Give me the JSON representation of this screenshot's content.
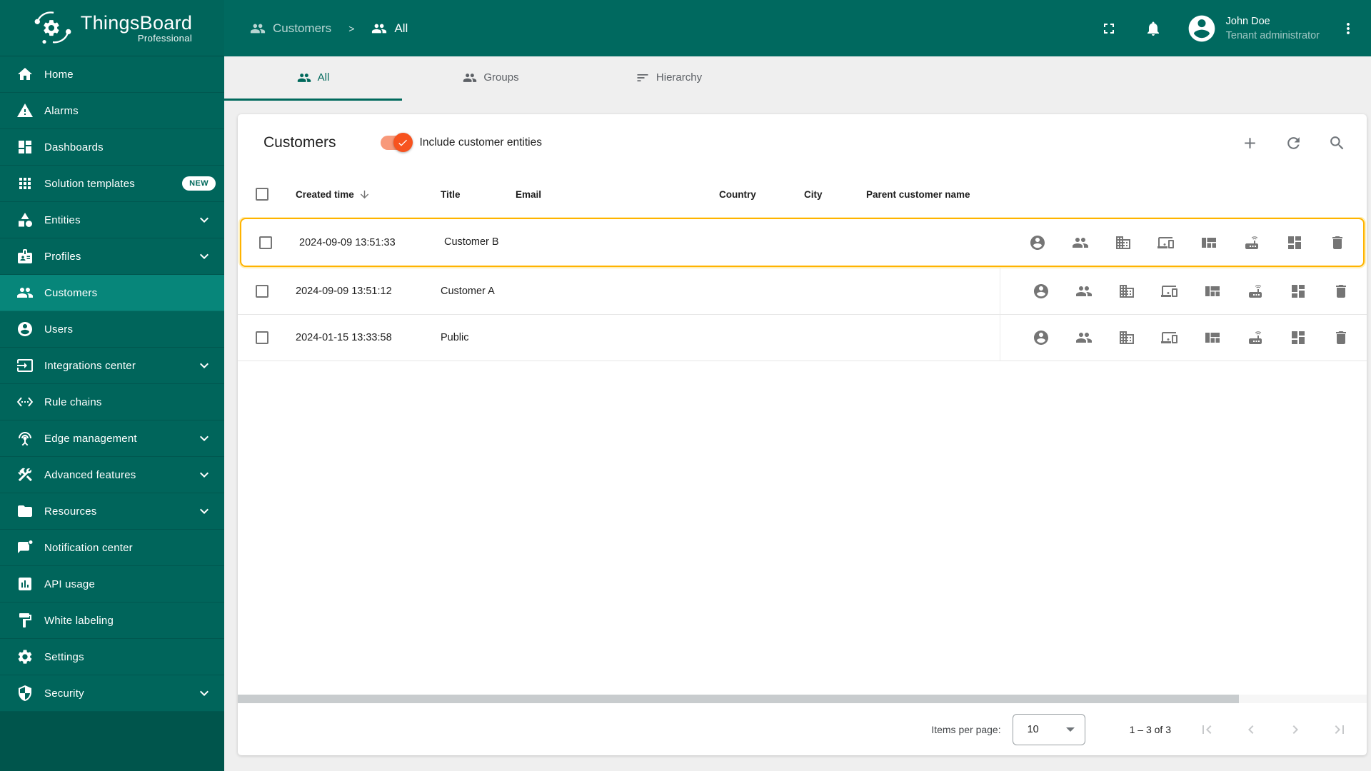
{
  "brand": {
    "name": "ThingsBoard",
    "edition": "Professional"
  },
  "topbar": {
    "breadcrumb": {
      "parent": "Customers",
      "separator": ">",
      "current": "All"
    },
    "user": {
      "name": "John Doe",
      "role": "Tenant administrator"
    }
  },
  "sidebar": {
    "items": [
      {
        "label": "Home"
      },
      {
        "label": "Alarms"
      },
      {
        "label": "Dashboards"
      },
      {
        "label": "Solution templates",
        "badge": "NEW"
      },
      {
        "label": "Entities"
      },
      {
        "label": "Profiles"
      },
      {
        "label": "Customers"
      },
      {
        "label": "Users"
      },
      {
        "label": "Integrations center"
      },
      {
        "label": "Rule chains"
      },
      {
        "label": "Edge management"
      },
      {
        "label": "Advanced features"
      },
      {
        "label": "Resources"
      },
      {
        "label": "Notification center"
      },
      {
        "label": "API usage"
      },
      {
        "label": "White labeling"
      },
      {
        "label": "Settings"
      },
      {
        "label": "Security"
      }
    ],
    "selected": "Customers"
  },
  "tabs": [
    {
      "label": "All",
      "active": true
    },
    {
      "label": "Groups",
      "active": false
    },
    {
      "label": "Hierarchy",
      "active": false
    }
  ],
  "panel": {
    "title": "Customers",
    "toggle_label": "Include customer entities",
    "toggle_on": true
  },
  "table": {
    "columns": {
      "created": "Created time",
      "title": "Title",
      "email": "Email",
      "country": "Country",
      "city": "City",
      "parent": "Parent customer name"
    },
    "sorted_by": "Created time",
    "sort_direction": "desc",
    "rows": [
      {
        "created": "2024-09-09 13:51:33",
        "title": "Customer B",
        "email": "",
        "country": "",
        "city": "",
        "parent": "",
        "highlighted": true
      },
      {
        "created": "2024-09-09 13:51:12",
        "title": "Customer A",
        "email": "",
        "country": "",
        "city": "",
        "parent": "",
        "highlighted": false
      },
      {
        "created": "2024-01-15 13:33:58",
        "title": "Public",
        "email": "",
        "country": "",
        "city": "",
        "parent": "",
        "highlighted": false
      }
    ],
    "row_actions": [
      "manage-users",
      "manage-customers",
      "manage-assets",
      "manage-devices",
      "manage-entity-views",
      "manage-edges",
      "manage-dashboards",
      "delete"
    ]
  },
  "pagination": {
    "items_per_page_label": "Items per page:",
    "items_per_page": "10",
    "range_label": "1 – 3 of 3"
  },
  "colors": {
    "topbar": "#00695f",
    "sidebar": "#00655b",
    "sidebar_selected": "#07867a",
    "accent": "#00695c",
    "toggle_thumb": "#f7531f",
    "toggle_track": "#f8997a",
    "highlight_border": "#ffb300"
  }
}
